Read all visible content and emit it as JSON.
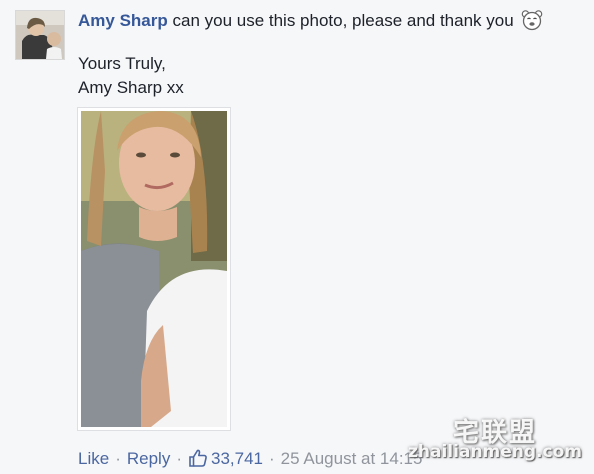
{
  "comment": {
    "author": "Amy Sharp",
    "text": "can you use this photo, please and thank you",
    "emoji_icon": "smiling-bear-emoji-icon",
    "body_lines": [
      "Yours Truly,",
      "Amy Sharp xx"
    ]
  },
  "actions": {
    "like": "Like",
    "separator": "·",
    "reply": "Reply",
    "like_icon": "thumbs-up-icon",
    "like_count": "33,741",
    "timestamp": "25 August at 14:15"
  },
  "watermark": {
    "logo": "宅联盟",
    "url": "zhailianmeng.com"
  },
  "colors": {
    "background": "#f6f7f9",
    "author_link": "#365899",
    "action_link": "#4b67a1",
    "meta_text": "#90949c"
  }
}
